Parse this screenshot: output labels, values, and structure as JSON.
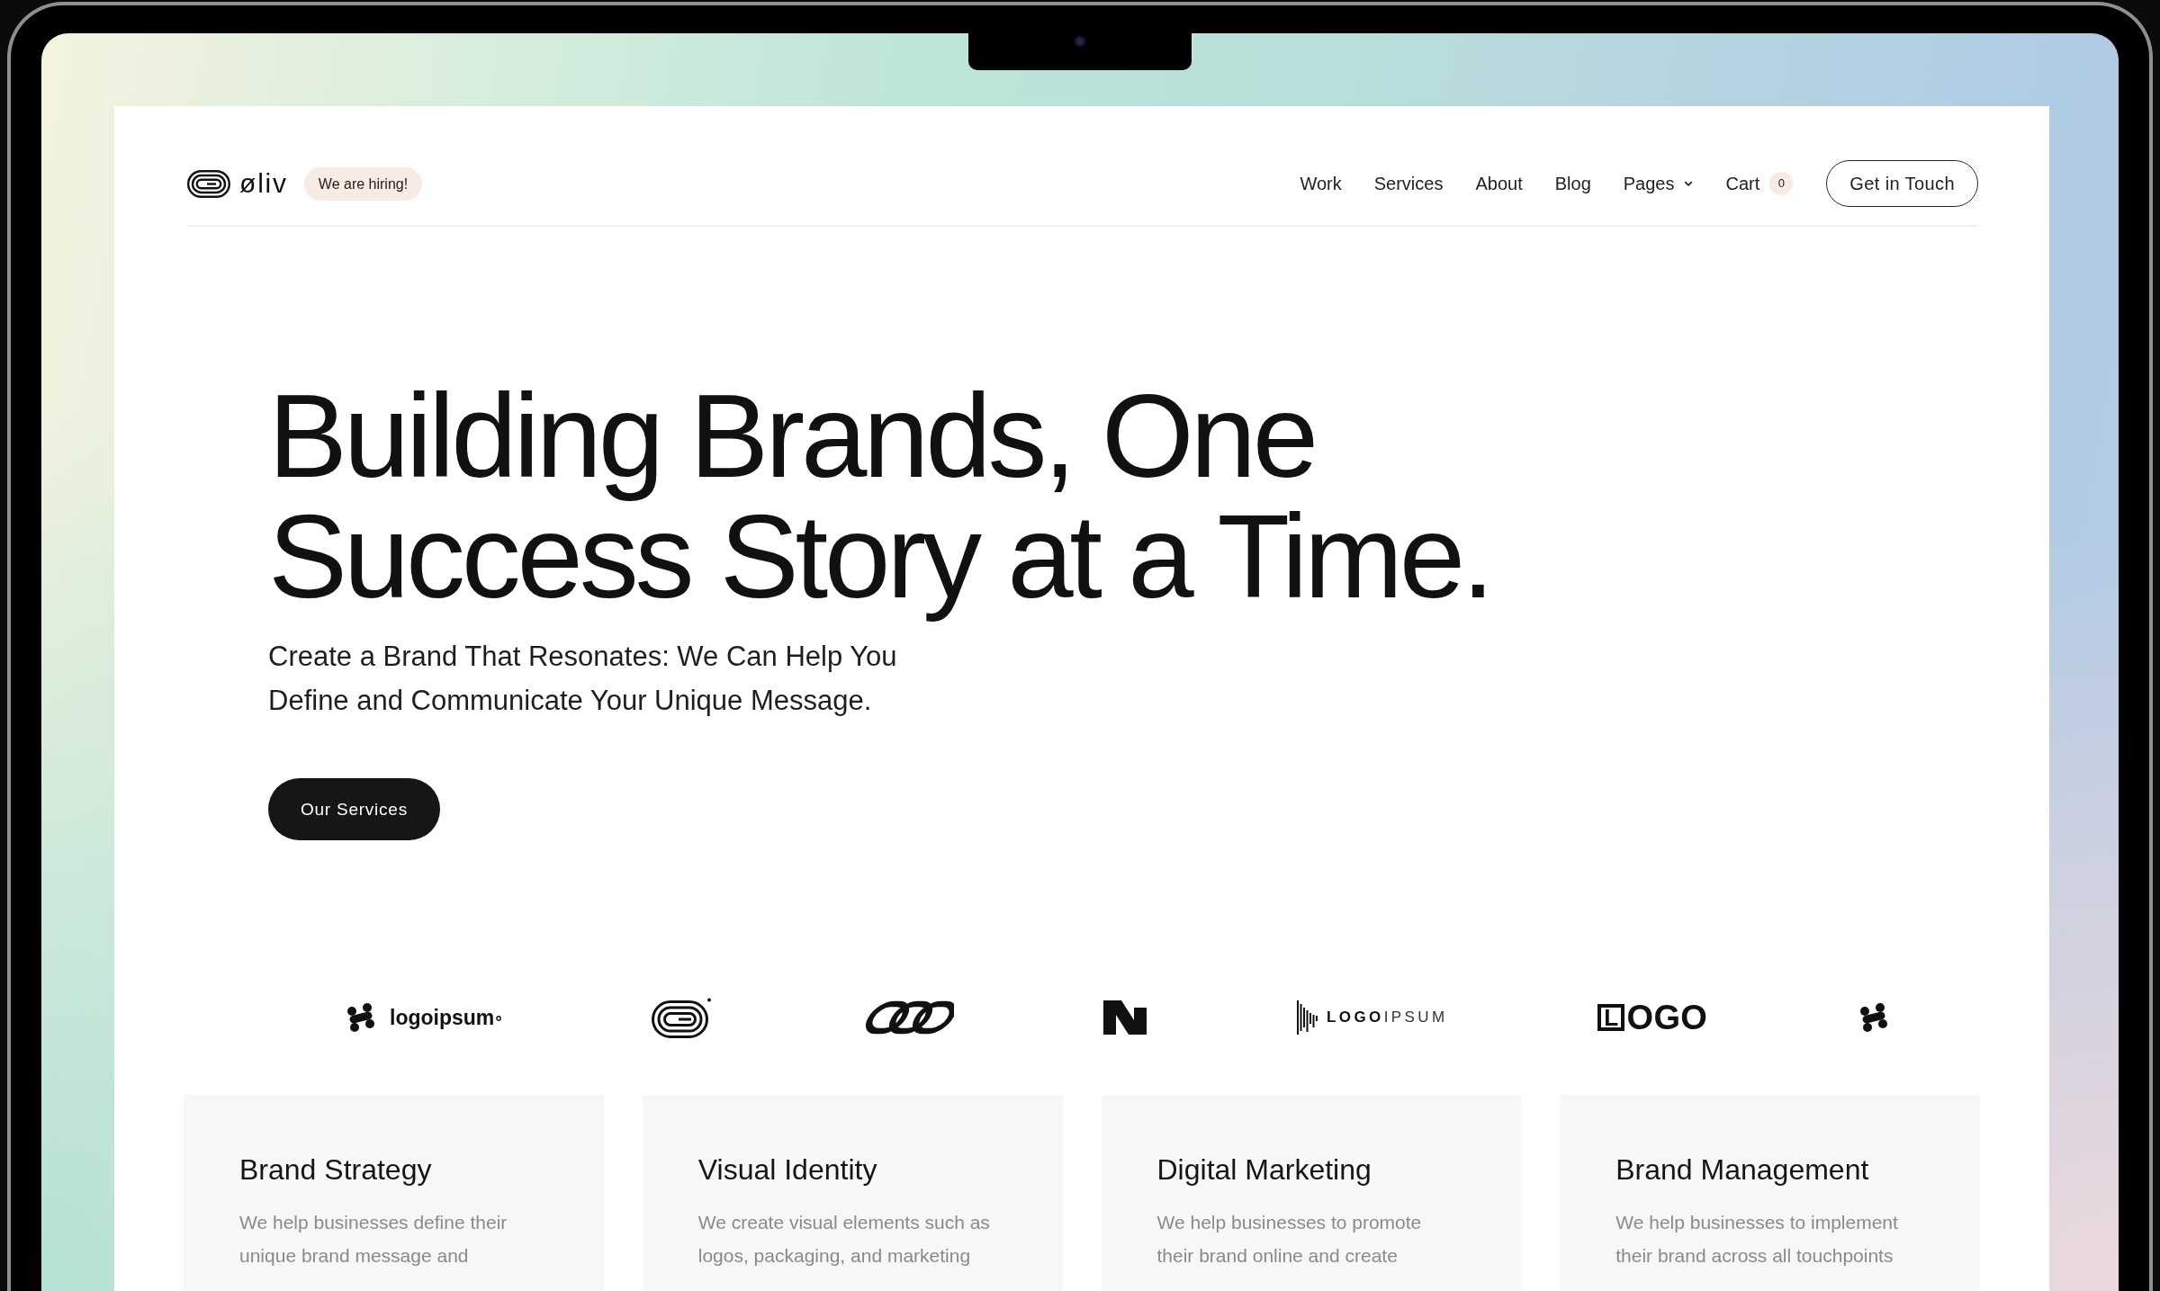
{
  "header": {
    "brand": "øliv",
    "badge": "We are hiring!",
    "nav": [
      {
        "kind": "link",
        "label": "Work"
      },
      {
        "kind": "link",
        "label": "Services"
      },
      {
        "kind": "link",
        "label": "About"
      },
      {
        "kind": "link",
        "label": "Blog"
      },
      {
        "kind": "dropdown",
        "label": "Pages"
      },
      {
        "kind": "cart",
        "label": "Cart",
        "count": "0"
      }
    ],
    "cta": "Get in Touch"
  },
  "hero": {
    "title_lines": [
      "Building Brands, One",
      "Success Story at a Time."
    ],
    "subtitle_lines": [
      "Create a Brand That Resonates: We Can Help You",
      "Define and Communicate Your Unique Message."
    ],
    "button": "Our Services"
  },
  "logos": [
    {
      "kind": "cluster-wordmark",
      "text": "logoipsum"
    },
    {
      "kind": "rings"
    },
    {
      "kind": "chain"
    },
    {
      "kind": "n-mark"
    },
    {
      "kind": "bars-wordmark",
      "text": "**LOGO**IPSUM"
    },
    {
      "kind": "boxed-wordmark",
      "text": "LOGO"
    },
    {
      "kind": "cluster"
    }
  ],
  "services": [
    {
      "title": "Brand Strategy",
      "description_lines": [
        "We help businesses define their",
        "unique brand message and"
      ]
    },
    {
      "title": "Visual Identity",
      "description_lines": [
        "We create visual elements such as",
        "logos, packaging, and marketing"
      ]
    },
    {
      "title": "Digital Marketing",
      "description_lines": [
        "We help businesses to promote",
        "their brand online and create"
      ]
    },
    {
      "title": "Brand Management",
      "description_lines": [
        "We help businesses to implement",
        "their brand across all touchpoints"
      ]
    }
  ]
}
